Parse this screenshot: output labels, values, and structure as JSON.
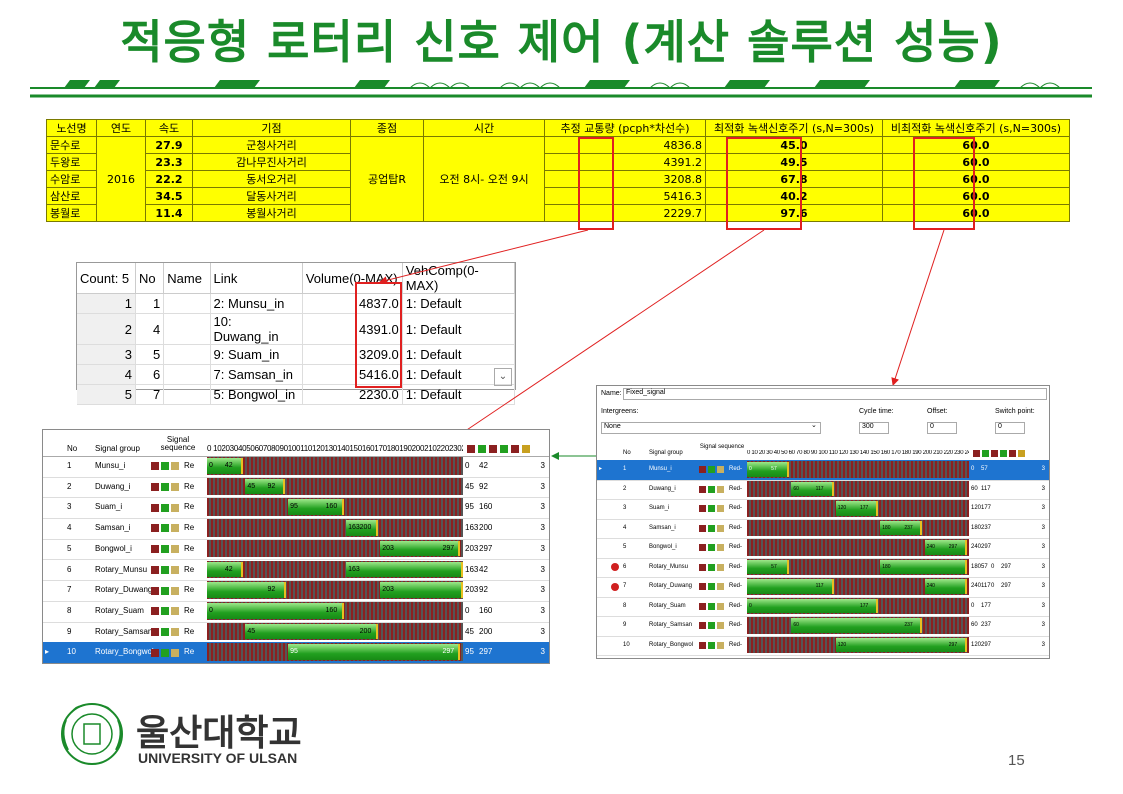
{
  "title": "적응형 로터리 신호 제어 (계산 솔루션 성능)",
  "top_table": {
    "headers": [
      "노선명",
      "연도",
      "속도",
      "기점",
      "종점",
      "시간",
      "추정 교통량 (pcph*차선수)",
      "최적화 녹색신호주기 (s,N=300s)",
      "비최적화 녹색신호주기 (s,N=300s)"
    ],
    "year": "2016",
    "end_point": "공업탑R",
    "time": "오전 8시- 오전 9시",
    "rows": [
      {
        "name": "문수로",
        "speed": "27.9",
        "start": "군청사거리",
        "volume": "4836.8",
        "opt": "45.0",
        "nonopt": "60.0"
      },
      {
        "name": "두왕로",
        "speed": "23.3",
        "start": "감나무진사거리",
        "volume": "4391.2",
        "opt": "49.5",
        "nonopt": "60.0"
      },
      {
        "name": "수암로",
        "speed": "22.2",
        "start": "동서오거리",
        "volume": "3208.8",
        "opt": "67.8",
        "nonopt": "60.0"
      },
      {
        "name": "삼산로",
        "speed": "34.5",
        "start": "달동사거리",
        "volume": "5416.3",
        "opt": "40.2",
        "nonopt": "60.0"
      },
      {
        "name": "봉월로",
        "speed": "11.4",
        "start": "봉월사거리",
        "volume": "2229.7",
        "opt": "97.6",
        "nonopt": "60.0"
      }
    ]
  },
  "mid_table": {
    "headers": [
      "Count: 5",
      "No",
      "Name",
      "Link",
      "Volume(0-MAX)",
      "VehComp(0-MAX)"
    ],
    "rows": [
      {
        "count": "1",
        "no": "1",
        "name": "",
        "link": "2: Munsu_in",
        "volume": "4837.0",
        "vehcomp": "1: Default"
      },
      {
        "count": "2",
        "no": "4",
        "name": "",
        "link": "10: Duwang_in",
        "volume": "4391.0",
        "vehcomp": "1: Default"
      },
      {
        "count": "3",
        "no": "5",
        "name": "",
        "link": "9: Suam_in",
        "volume": "3209.0",
        "vehcomp": "1: Default"
      },
      {
        "count": "4",
        "no": "6",
        "name": "",
        "link": "7: Samsan_in",
        "volume": "5416.0",
        "vehcomp": "1: Default"
      },
      {
        "count": "5",
        "no": "7",
        "name": "",
        "link": "5: Bongwol_in",
        "volume": "2230.0",
        "vehcomp": "1: Default"
      }
    ]
  },
  "left_panel": {
    "headers": {
      "no": "No",
      "group": "Signal group",
      "seq": "Signal sequence",
      "scale": "0 102030405060708090100110120130140150160170180190200210220230240250260270280290"
    },
    "seq_label": "Re",
    "rows": [
      {
        "no": "1",
        "group": "Munsu_i",
        "start": 0,
        "end": 42,
        "a": "0",
        "b": "42",
        "last": "3"
      },
      {
        "no": "2",
        "group": "Duwang_i",
        "start": 45,
        "end": 92,
        "a": "45",
        "b": "92",
        "last": "3"
      },
      {
        "no": "3",
        "group": "Suam_i",
        "start": 95,
        "end": 160,
        "a": "95",
        "b": "160",
        "last": "3"
      },
      {
        "no": "4",
        "group": "Samsan_i",
        "start": 163,
        "end": 200,
        "a": "163",
        "b": "200",
        "last": "3"
      },
      {
        "no": "5",
        "group": "Bongwol_i",
        "start": 203,
        "end": 297,
        "a": "203",
        "b": "297",
        "last": "3"
      },
      {
        "no": "6",
        "group": "Rotary_Munsu",
        "start": 0,
        "end": 42,
        "start2": 163,
        "end2": 300,
        "a": "163",
        "b": "42",
        "last": "3"
      },
      {
        "no": "7",
        "group": "Rotary_Duwang",
        "start": 0,
        "end": 92,
        "start2": 203,
        "end2": 300,
        "a": "203",
        "b": "92",
        "last": "3"
      },
      {
        "no": "8",
        "group": "Rotary_Suam",
        "start": 0,
        "end": 160,
        "a": "0",
        "b": "160",
        "last": "3"
      },
      {
        "no": "9",
        "group": "Rotary_Samsan",
        "start": 45,
        "end": 200,
        "a": "45",
        "b": "200",
        "last": "3"
      },
      {
        "no": "10",
        "group": "Rotary_Bongwol",
        "start": 95,
        "end": 297,
        "a": "95",
        "b": "297",
        "last": "3"
      }
    ]
  },
  "right_panel": {
    "name_label": "Name:",
    "name_value": "Fixed_signal",
    "intergreens_label": "Intergreens:",
    "intergreens_value": "None",
    "cycle_label": "Cycle time:",
    "cycle_value": "300",
    "offset_label": "Offset:",
    "offset_value": "0",
    "switch_label": "Switch point:",
    "switch_value": "0",
    "headers": {
      "no": "No",
      "group": "Signal group",
      "seq": "Signal sequence",
      "scale": "0 10 20 30 40 50 60 70 80 90 100 110 120 130 140 150 160 170 180 190 200 210 220 230 240 250 260 270 280 290"
    },
    "seq_label": "Red-",
    "rows": [
      {
        "no": "1",
        "group": "Munsu_i",
        "start": 0,
        "end": 57,
        "a": "0",
        "b": "57",
        "c": "",
        "d": "",
        "last": "3"
      },
      {
        "no": "2",
        "group": "Duwang_i",
        "start": 60,
        "end": 117,
        "a": "60",
        "b": "117",
        "c": "",
        "d": "",
        "last": "3"
      },
      {
        "no": "3",
        "group": "Suam_i",
        "start": 120,
        "end": 177,
        "a": "120",
        "b": "177",
        "c": "",
        "d": "",
        "last": "3"
      },
      {
        "no": "4",
        "group": "Samsan_i",
        "start": 180,
        "end": 237,
        "a": "180",
        "b": "237",
        "c": "",
        "d": "",
        "last": "3"
      },
      {
        "no": "5",
        "group": "Bongwol_i",
        "start": 240,
        "end": 297,
        "a": "240",
        "b": "297",
        "c": "",
        "d": "",
        "last": "3"
      },
      {
        "no": "6",
        "group": "Rotary_Munsu",
        "start": 0,
        "end": 57,
        "start2": 180,
        "end2": 297,
        "a": "180",
        "b": "57",
        "c": "0",
        "d": "297",
        "last": "3",
        "warn": true
      },
      {
        "no": "7",
        "group": "Rotary_Duwang",
        "start": 0,
        "end": 117,
        "start2": 240,
        "end2": 297,
        "a": "240",
        "b": "117",
        "c": "0",
        "d": "297",
        "last": "3",
        "warn": true
      },
      {
        "no": "8",
        "group": "Rotary_Suam",
        "start": 0,
        "end": 177,
        "a": "0",
        "b": "177",
        "c": "",
        "d": "",
        "last": "3"
      },
      {
        "no": "9",
        "group": "Rotary_Samsan",
        "start": 60,
        "end": 237,
        "a": "60",
        "b": "237",
        "c": "",
        "d": "",
        "last": "3"
      },
      {
        "no": "10",
        "group": "Rotary_Bongwol",
        "start": 120,
        "end": 297,
        "a": "120",
        "b": "297",
        "c": "",
        "d": "",
        "last": "3"
      }
    ]
  },
  "logo": {
    "korean": "울산대학교",
    "english": "UNIVERSITY OF ULSAN"
  },
  "page_number": "15",
  "colors": {
    "title": "#1a8a2a",
    "highlight": "#ffff00",
    "annotation": "#e02020",
    "green_bar": "#22a020",
    "selection": "#1e74d0"
  }
}
